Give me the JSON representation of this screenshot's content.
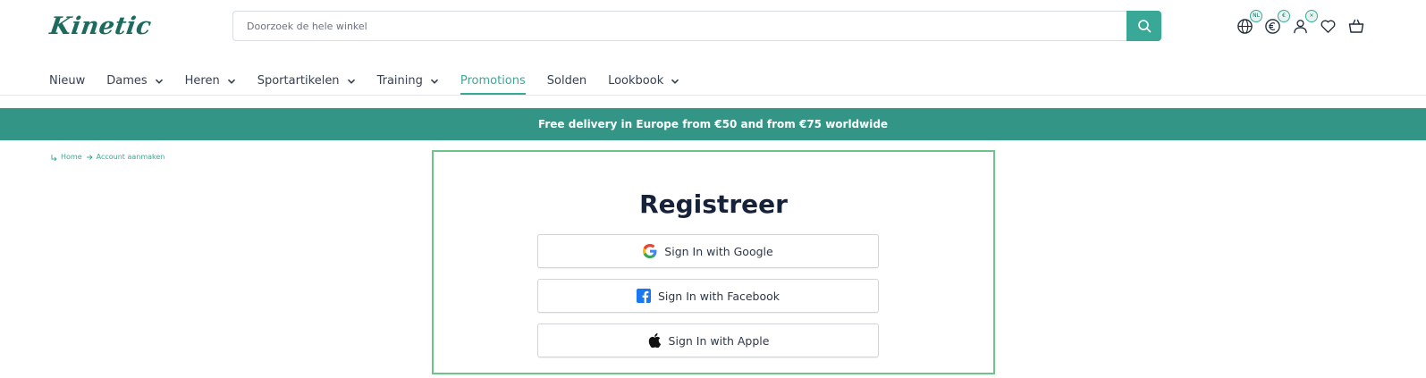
{
  "header": {
    "logo_text": "Kinetic",
    "search": {
      "placeholder": "Doorzoek de hele winkel"
    },
    "icons": [
      {
        "name": "globe-icon",
        "badge": "NL"
      },
      {
        "name": "euro-icon",
        "badge": "€"
      },
      {
        "name": "user-icon",
        "badge": "×"
      },
      {
        "name": "heart-icon",
        "badge": ""
      },
      {
        "name": "basket-icon",
        "badge": ""
      }
    ]
  },
  "nav": {
    "items": [
      {
        "label": "Nieuw",
        "has_dropdown": false,
        "active": false
      },
      {
        "label": "Dames",
        "has_dropdown": true,
        "active": false
      },
      {
        "label": "Heren",
        "has_dropdown": true,
        "active": false
      },
      {
        "label": "Sportartikelen",
        "has_dropdown": true,
        "active": false
      },
      {
        "label": "Training",
        "has_dropdown": true,
        "active": false
      },
      {
        "label": "Promotions",
        "has_dropdown": false,
        "active": true
      },
      {
        "label": "Solden",
        "has_dropdown": false,
        "active": false
      },
      {
        "label": "Lookbook",
        "has_dropdown": true,
        "active": false
      }
    ]
  },
  "banner": {
    "text": "Free delivery in Europe from €50 and from €75 worldwide"
  },
  "breadcrumb": {
    "home": "Home",
    "current": "Account aanmaken"
  },
  "register": {
    "title": "Registreer",
    "google_label": "Sign In with Google",
    "facebook_label": "Sign In with Facebook",
    "apple_label": "Sign In with Apple"
  },
  "colors": {
    "accent": "#3aa896",
    "banner_bg": "#339585",
    "logo": "#1d6b5e",
    "panel_border": "#6cc48a",
    "title": "#16213a"
  }
}
